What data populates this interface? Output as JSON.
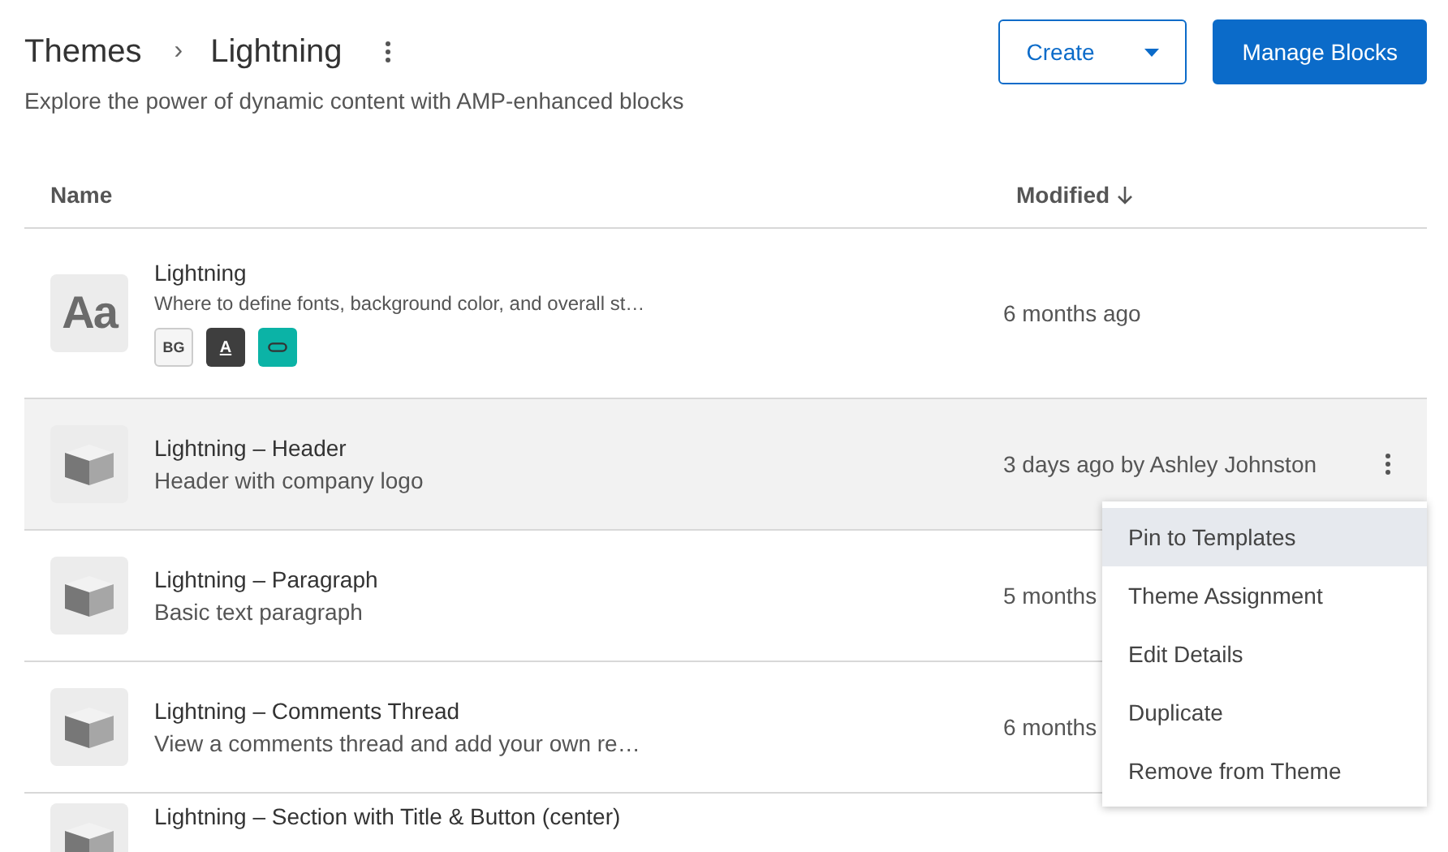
{
  "breadcrumb": {
    "parent": "Themes",
    "separator": "›",
    "current": "Lightning"
  },
  "subtitle": "Explore the power of dynamic content with AMP-enhanced blocks",
  "buttons": [
    {
      "label": "Create",
      "kind": "dropdown"
    },
    {
      "label": "Manage Blocks",
      "kind": "primary"
    }
  ],
  "table": {
    "columns": [
      {
        "label": "Name",
        "sorted": false
      },
      {
        "label": "Modified",
        "sorted": true
      }
    ],
    "rows": [
      {
        "kind": "theme",
        "thumbnail": "Aa",
        "title": "Lightning",
        "description": "Where to define fonts, background color, and overall st…",
        "modified": "6 months ago",
        "selected": false,
        "badges": [
          {
            "kind": "text",
            "label": "BG"
          },
          {
            "kind": "font-color",
            "label": "A"
          },
          {
            "kind": "link"
          }
        ]
      },
      {
        "kind": "block",
        "title": "Lightning – Header",
        "description": "Header with company logo",
        "modified": "3 days ago by Ashley Johnston",
        "selected": true
      },
      {
        "kind": "block",
        "title": "Lightning – Paragraph",
        "description": "Basic text paragraph",
        "modified": "5 months",
        "selected": false
      },
      {
        "kind": "block",
        "title": "Lightning – Comments Thread",
        "description": "View a comments thread and add your own re…",
        "modified": "6 months",
        "selected": false
      },
      {
        "kind": "block",
        "title": "Lightning – Section with Title & Button (center)",
        "selected": false
      }
    ]
  },
  "menu": {
    "items": [
      {
        "label": "Pin to Templates",
        "selected": true
      },
      {
        "label": "Theme Assignment",
        "selected": false
      },
      {
        "label": "Edit Details",
        "selected": false
      },
      {
        "label": "Duplicate",
        "selected": false
      },
      {
        "label": "Remove from Theme",
        "selected": false
      }
    ]
  }
}
